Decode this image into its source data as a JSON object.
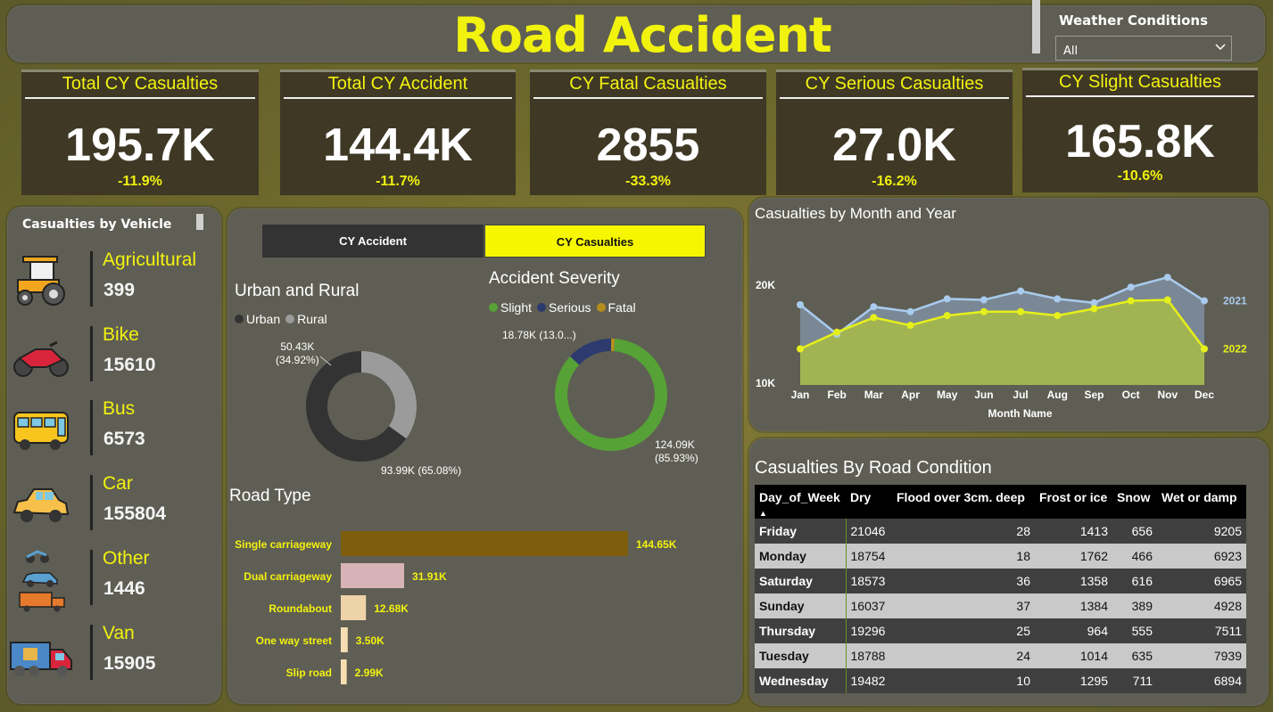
{
  "header": {
    "title": "Road Accident",
    "filter_label": "Weather Conditions",
    "filter_value": "All"
  },
  "kpis": [
    {
      "title": "Total CY Casualties",
      "value": "195.7K",
      "change": "-11.9%"
    },
    {
      "title": "Total CY Accident",
      "value": "144.4K",
      "change": "-11.7%"
    },
    {
      "title": "CY Fatal Casualties",
      "value": "2855",
      "change": "-33.3%"
    },
    {
      "title": "CY Serious Casualties",
      "value": "27.0K",
      "change": "-16.2%"
    },
    {
      "title": "CY Slight Casualties",
      "value": "165.8K",
      "change": "-10.6%"
    }
  ],
  "vehicles": {
    "title": "Casualties by Vehicle",
    "items": [
      {
        "name": "Agricultural",
        "value": "399",
        "icon": "tractor-icon"
      },
      {
        "name": "Bike",
        "value": "15610",
        "icon": "motorbike-icon"
      },
      {
        "name": "Bus",
        "value": "6573",
        "icon": "bus-icon"
      },
      {
        "name": "Car",
        "value": "155804",
        "icon": "car-icon"
      },
      {
        "name": "Other",
        "value": "1446",
        "icon": "mixed-vehicles-icon"
      },
      {
        "name": "Van",
        "value": "15905",
        "icon": "van-icon"
      }
    ]
  },
  "tabs": {
    "accident": "CY Accident",
    "casualties": "CY Casualties",
    "active": "casualties"
  },
  "colors": {
    "accent": "#f2f20f",
    "panel": "#5f5e54",
    "kpi_bg": "#3e3825",
    "line2021": "#a9cbed",
    "line2022": "#e6f01a",
    "slight": "#56a236",
    "serious": "#2c3a6e",
    "fatal": "#b48f1e",
    "urban": "#333333",
    "rural": "#9b9b9b"
  },
  "chart_data": [
    {
      "type": "pie",
      "title": "Urban and Rural",
      "legend": [
        "Urban",
        "Rural"
      ],
      "values": [
        93.99,
        50.43
      ],
      "labels": [
        "93.99K (65.08%)",
        "50.43K\n(34.92%)"
      ]
    },
    {
      "type": "pie",
      "title": "Accident Severity",
      "legend": [
        "Slight",
        "Serious",
        "Fatal"
      ],
      "values": [
        124.09,
        18.78,
        1.54
      ],
      "labels": [
        "124.09K\n(85.93%)",
        "18.78K (13.0...)",
        ""
      ]
    },
    {
      "type": "bar",
      "title": "Road Type",
      "orientation": "horizontal",
      "categories": [
        "Single carriageway",
        "Dual carriageway",
        "Roundabout",
        "One way street",
        "Slip road"
      ],
      "values": [
        144.65,
        31.91,
        12.68,
        3.5,
        2.99
      ],
      "value_labels": [
        "144.65K",
        "31.91K",
        "12.68K",
        "3.50K",
        "2.99K"
      ],
      "bar_colors": [
        "#7d5d0b",
        "#d7b3b7",
        "#efd3a8",
        "#f7deb2",
        "#f7deb2"
      ]
    },
    {
      "type": "area",
      "title": "Casualties by Month and Year",
      "xlabel": "Month Name",
      "categories": [
        "Jan",
        "Feb",
        "Mar",
        "Apr",
        "May",
        "Jun",
        "Jul",
        "Aug",
        "Sep",
        "Oct",
        "Nov",
        "Dec"
      ],
      "ylim": [
        10000,
        22000
      ],
      "yticks": [
        "20K",
        "10K"
      ],
      "yticks_values": [
        20000,
        10000
      ],
      "series": [
        {
          "name": "2021",
          "values": [
            18000,
            15000,
            17800,
            17300,
            18600,
            18500,
            19400,
            18600,
            18200,
            19800,
            20800,
            18400
          ]
        },
        {
          "name": "2022",
          "values": [
            13500,
            15200,
            16700,
            15900,
            16900,
            17300,
            17300,
            16900,
            17600,
            18400,
            18500,
            13500
          ]
        }
      ]
    },
    {
      "type": "table",
      "title": "Casualties By Road Condition",
      "columns": [
        "Day_of_Week",
        "Dry",
        "Flood over 3cm. deep",
        "Frost or ice",
        "Snow",
        "Wet or damp"
      ],
      "rows": [
        [
          "Friday",
          "21046",
          "28",
          "1413",
          "656",
          "9205"
        ],
        [
          "Monday",
          "18754",
          "18",
          "1762",
          "466",
          "6923"
        ],
        [
          "Saturday",
          "18573",
          "36",
          "1358",
          "616",
          "6965"
        ],
        [
          "Sunday",
          "16037",
          "37",
          "1384",
          "389",
          "4928"
        ],
        [
          "Thursday",
          "19296",
          "25",
          "964",
          "555",
          "7511"
        ],
        [
          "Tuesday",
          "18788",
          "24",
          "1014",
          "635",
          "7939"
        ],
        [
          "Wednesday",
          "19482",
          "10",
          "1295",
          "711",
          "6894"
        ]
      ]
    }
  ]
}
